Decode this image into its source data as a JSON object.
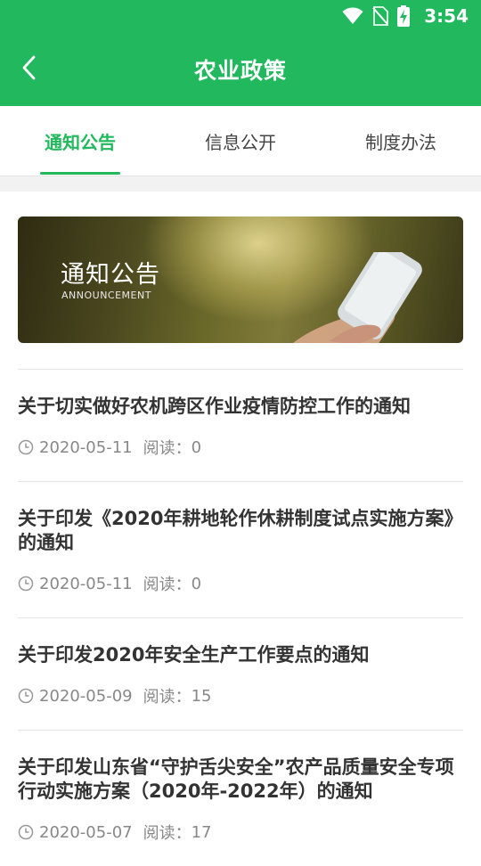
{
  "status_bar": {
    "time": "3:54"
  },
  "header": {
    "title": "农业政策"
  },
  "tabs": [
    {
      "label": "通知公告",
      "active": true
    },
    {
      "label": "信息公开",
      "active": false
    },
    {
      "label": "制度办法",
      "active": false
    }
  ],
  "banner": {
    "title": "通知公告",
    "subtitle": "ANNOUNCEMENT"
  },
  "read_label": "阅读：",
  "items": [
    {
      "title": "关于切实做好农机跨区作业疫情防控工作的通知",
      "date": "2020-05-11",
      "reads": "0"
    },
    {
      "title": "关于印发《2020年耕地轮作休耕制度试点实施方案》的通知",
      "date": "2020-05-11",
      "reads": "0"
    },
    {
      "title": "关于印发2020年安全生产工作要点的通知",
      "date": "2020-05-09",
      "reads": "15"
    },
    {
      "title": "关于印发山东省“守护舌尖安全”农产品质量安全专项行动实施方案（2020年-2022年）的通知",
      "date": "2020-05-07",
      "reads": "17"
    }
  ],
  "colors": {
    "accent": "#22b85d",
    "text": "#333333",
    "meta": "#888888"
  }
}
